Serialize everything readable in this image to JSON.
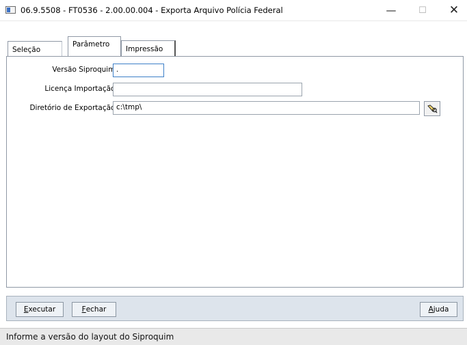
{
  "window": {
    "title": "06.9.5508 - FT0536 - 2.00.00.004 - Exporta Arquivo Polícia Federal",
    "minimize_glyph": "—",
    "maximize_glyph": "☐",
    "close_glyph": "✕"
  },
  "tabs": [
    {
      "label": "Seleção",
      "selected": false
    },
    {
      "label": "Parâmetro",
      "selected": true
    },
    {
      "label": "Impressão",
      "selected": false
    }
  ],
  "form": {
    "versao": {
      "label": "Versão Siproquim:",
      "value": "."
    },
    "licenca": {
      "label": "Licença Importação:",
      "value": ""
    },
    "diretorio": {
      "label": "Diretório de Exportação:",
      "value": "c:\\tmp\\"
    },
    "folder_icon": "folder-search-icon"
  },
  "buttons": {
    "executar": {
      "prefix": "E",
      "rest": "xecutar"
    },
    "fechar": {
      "prefix": "F",
      "rest": "echar"
    },
    "ajuda": {
      "prefix": "A",
      "rest": "juda"
    }
  },
  "status": {
    "text": "Informe a versão do layout do Siproquim"
  },
  "colors": {
    "focus_border": "#3c7fc8",
    "button_bar": "#dde4ec",
    "status_bar": "#e9e9e9"
  }
}
